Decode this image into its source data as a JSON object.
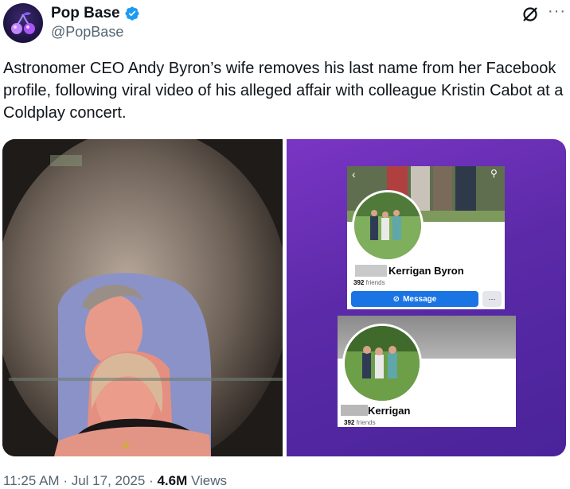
{
  "author": {
    "display_name": "Pop Base",
    "handle": "@PopBase",
    "verified": true,
    "avatar_icon": "cherry-logo-icon"
  },
  "header_actions": {
    "grok_icon": "grok-icon",
    "more_icon": "more-horizontal-icon"
  },
  "tweet": {
    "text": "Astronomer CEO Andy Byron’s wife removes his last name from her Facebook profile, following viral video of his alleged affair with colleague Kristin Cabot at a Coldplay concert."
  },
  "media": {
    "left_image": "concert-kiss-cam-photo",
    "right_image": {
      "card1": {
        "name": "Kerrigan Byron",
        "friends_count": "392",
        "friends_label": "friends",
        "message_button": "Message",
        "more_button": "···"
      },
      "card2": {
        "name": "Kerrigan",
        "friends_count": "392",
        "friends_label": "friends"
      }
    }
  },
  "footer": {
    "time": "11:25 AM",
    "date": "Jul 17, 2025",
    "views_count": "4.6M",
    "views_label": "Views"
  },
  "colors": {
    "text_primary": "#0f1419",
    "text_secondary": "#536471",
    "verified_blue": "#1d9bf0",
    "facebook_blue": "#1b74e4",
    "purple_bg": "#5b2aa8"
  }
}
